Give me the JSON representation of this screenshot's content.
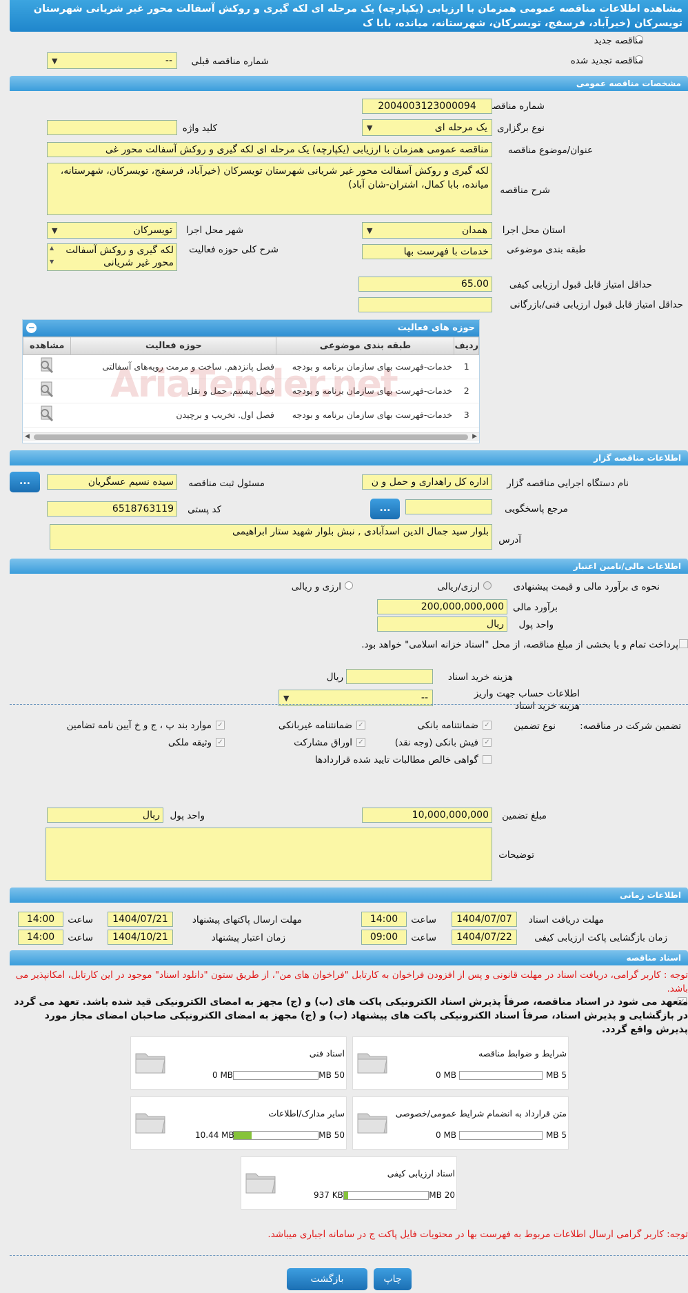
{
  "header": {
    "title": "مشاهده اطلاعات مناقصه عمومی همزمان با ارزیابی (یکپارچه) یک مرحله ای لکه گیری و روکش آسفالت محور غیر شریانی شهرستان تویسرکان (خیرآباد، فرسفج، تویسرکان، شهرستانه، میانده، بابا ک"
  },
  "tender_type": {
    "new_label": "مناقصه جدید",
    "renewed_label": "مناقصه تجدید شده",
    "prev_number_label": "شماره مناقصه قبلی",
    "prev_number_value": "--"
  },
  "general": {
    "section_title": "مشخصات مناقصه عمومی",
    "number_label": "شماره مناقصه",
    "number_value": "2004003123000094",
    "hold_type_label": "نوع برگزاری",
    "hold_type_value": "یک مرحله ای",
    "keyword_label": "کلید واژه",
    "keyword_value": "",
    "subject_label": "عنوان/موضوع مناقصه",
    "subject_value": "مناقصه عمومی همزمان با ارزیابی (یکپارچه) یک مرحله ای لکه گیری و روکش آسفالت محور غی",
    "desc_label": "شرح مناقصه",
    "desc_value": "لکه گیری و روکش آسفالت محور غیر شریانی شهرستان تویسرکان (خیرآباد، فرسفج، تویسرکان، شهرستانه، میانده، بابا کمال، اشتران-شان آباد)",
    "province_label": "استان محل اجرا",
    "province_value": "همدان",
    "city_label": "شهر محل اجرا",
    "city_value": "تویسرکان",
    "category_label": "طبقه بندی موضوعی",
    "category_value": "خدمات با فهرست بها",
    "activity_desc_label": "شرح کلی حوزه فعالیت",
    "activity_desc_value": "لکه گیری و روکش آسفالت محور غیر شریانی",
    "min_quality_label": "حداقل امتیاز قابل قبول ارزیابی کیفی",
    "min_quality_value": "65.00",
    "min_tech_label": "حداقل امتیاز قابل قبول ارزیابی فنی/بازرگانی",
    "min_tech_value": ""
  },
  "activities": {
    "title": "حوزه های فعالیت",
    "headers": [
      "ردیف",
      "طبقه بندی موضوعی",
      "حوزه فعالیت",
      "مشاهده"
    ],
    "rows": [
      {
        "idx": "1",
        "category": "خدمات-فهرست بهای سازمان برنامه و بودجه",
        "field": "فصل پانزدهم. ساخت و مرمت رویه‌های آسفالتی"
      },
      {
        "idx": "2",
        "category": "خدمات-فهرست بهای سازمان برنامه و بودجه",
        "field": "فصل بیستم. حمل و نقل"
      },
      {
        "idx": "3",
        "category": "خدمات-فهرست بهای سازمان برنامه و بودجه",
        "field": "فصل اول. تخریب و برچیدن"
      }
    ]
  },
  "organizer": {
    "section_title": "اطلاعات مناقصه گزار",
    "org_label": "نام دستگاه اجرایی مناقصه گزار",
    "org_value": "اداره کل راهداری و حمل و ن",
    "registrar_label": "مسئول ثبت مناقصه",
    "registrar_value": "سیده نسیم عسگریان",
    "ref_label": "مرجع پاسخگویی",
    "ref_value": "",
    "postal_label": "کد پستی",
    "postal_value": "6518763119",
    "address_label": "آدرس",
    "address_value": "بلوار سید جمال الدین اسدآبادی , نبش بلوار شهید ستار ابراهیمی",
    "dots": "..."
  },
  "finance": {
    "section_title": "اطلاعات مالی/تامین اعتبار",
    "method_label": "نحوه ی برآورد مالی و قیمت پیشنهادی",
    "opt1": "ارزی/ریالی",
    "opt2": "ارزی و ریالی",
    "estimate_label": "برآورد مالی",
    "estimate_value": "200,000,000,000",
    "currency_label": "واحد پول",
    "currency_value": "ریال",
    "treasury_text": "پرداخت تمام و یا بخشی از مبلغ مناقصه، از محل \"اسناد خزانه اسلامی\" خواهد بود.",
    "doc_fee_label": "هزینه خرید اسناد",
    "doc_fee_value": "",
    "doc_fee_unit": "ریال",
    "account_label": "اطلاعات حساب جهت واریز هزینه خرید اسناد",
    "account_value": "--"
  },
  "guarantee": {
    "label": "تضمین شرکت در مناقصه:",
    "type_label": "نوع تضمین",
    "options": [
      "ضمانتنامه بانکی",
      "ضمانتنامه غیربانکی",
      "موارد بند پ ، ج و خ آیین نامه تضامین",
      "فیش بانکی (وجه نقد)",
      "اوراق مشارکت",
      "وثیقه ملکی",
      "گواهی خالص مطالبات تایید شده قراردادها"
    ],
    "amount_label": "مبلغ تضمین",
    "amount_value": "10,000,000,000",
    "currency_label": "واحد پول",
    "currency_value": "ریال",
    "notes_label": "توضیحات",
    "notes_value": ""
  },
  "timing": {
    "section_title": "اطلاعات زمانی",
    "doc_deadline_label": "مهلت دریافت اسناد",
    "doc_deadline_date": "1404/07/07",
    "doc_deadline_time": "14:00",
    "send_deadline_label": "مهلت ارسال پاکتهای پیشنهاد",
    "send_deadline_date": "1404/07/21",
    "send_deadline_time": "14:00",
    "open_label": "زمان بازگشایی پاکت ارزیابی کیفی",
    "open_date": "1404/07/22",
    "open_time": "09:00",
    "validity_label": "زمان اعتبار پیشنهاد",
    "validity_date": "1404/10/21",
    "validity_time": "14:00",
    "time_label": "ساعت"
  },
  "docs": {
    "section_title": "اسناد مناقصه",
    "notice": "توجه : کاربر گرامی، دریافت اسناد در مهلت قانونی و پس از افزودن فراخوان به کارتابل \"فراخوان های من\"، از طریق ستون \"دانلود اسناد\" موجود در این کارتابل، امکانپذیر می باشد.",
    "commitment": "متعهد می شود در اسناد مناقصه، صرفاً پذیرش اسناد الکترونیکی پاکت های (ب) و (ج) مجهز به امضای الکترونیکی قید شده باشد. تعهد می گردد در بازگشایی و پذیرش اسناد، صرفاً اسناد الکترونیکی پاکت های پیشنهاد (ب) و (ج) مجهز به امضای الکترونیکی صاحبان امضای مجاز مورد پذیرش واقع گردد.",
    "items": [
      {
        "name": "شرایط و ضوابط مناقصه",
        "used": "0 MB",
        "max": "5 MB",
        "fill": 0
      },
      {
        "name": "اسناد فنی",
        "used": "0 MB",
        "max": "50 MB",
        "fill": 0
      },
      {
        "name": "متن قرارداد به انضمام شرایط عمومی/خصوصی",
        "used": "0 MB",
        "max": "5 MB",
        "fill": 0
      },
      {
        "name": "سایر مدارک/اطلاعات",
        "used": "10.44 MB",
        "max": "50 MB",
        "fill": 0.21
      },
      {
        "name": "اسناد ارزیابی کیفی",
        "used": "937 KB",
        "max": "20 MB",
        "fill": 0.05
      }
    ],
    "footer_notice": "توجه: کاربر گرامی ارسال اطلاعات مربوط به فهرست بها در محتویات فایل پاکت ج در سامانه اجباری میباشد."
  },
  "actions": {
    "back": "بازگشت",
    "print": "چاپ"
  },
  "watermark": "AriaTender.net"
}
